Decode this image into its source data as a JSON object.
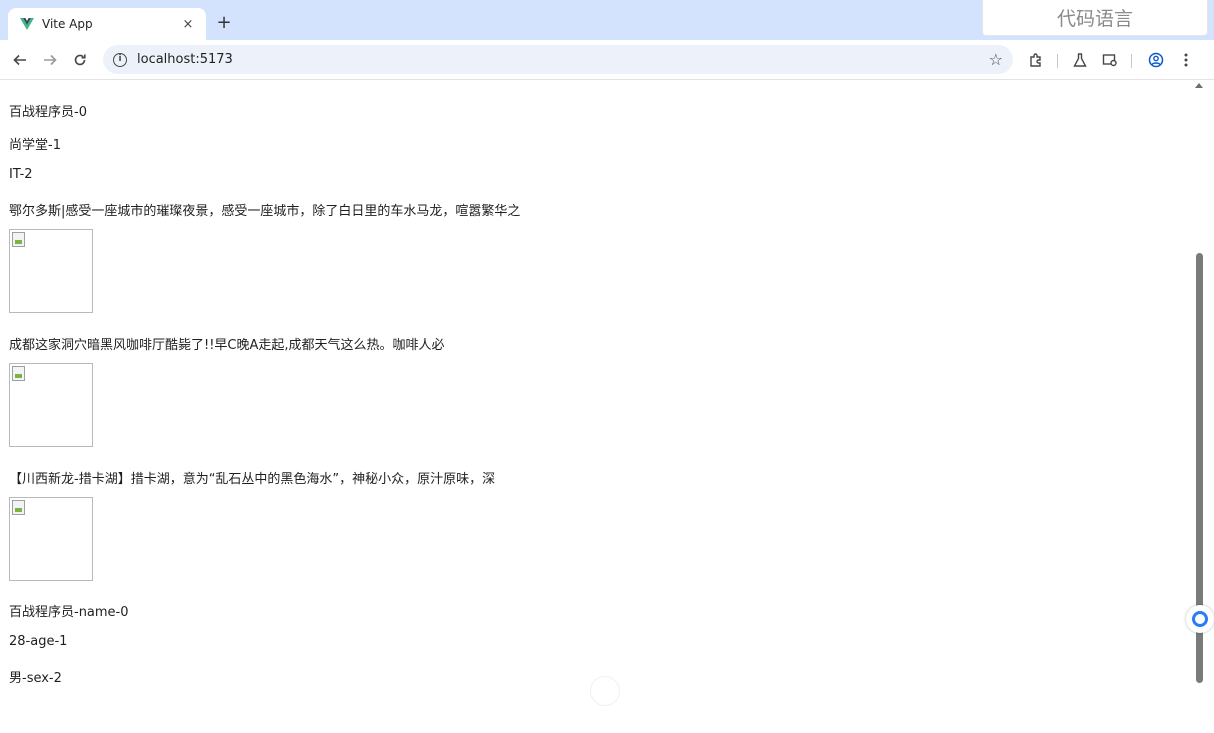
{
  "browser": {
    "tab": {
      "title": "Vite App",
      "close": "×"
    },
    "new_tab": "+",
    "url": "localhost:5173"
  },
  "overlay": {
    "text": "代码语言"
  },
  "page": {
    "simple_list": [
      "百战程序员-0",
      "尚学堂-1",
      "IT-2"
    ],
    "articles": [
      "鄂尔多斯|感受一座城市的璀璨夜景，感受一座城市，除了白日里的车水马龙，喧嚣繁华之",
      "成都这家洞穴暗黑风咖啡厅酷毙了!!早C晚A走起,成都天气这么热。咖啡人必",
      "【川西新龙-措卡湖】措卡湖，意为“乱石丛中的黑色海水”，神秘小众，原汁原味，深"
    ],
    "object_list": [
      "百战程序员-name-0",
      "28-age-1",
      "男-sex-2"
    ]
  },
  "colors": {
    "tab_strip": "#d3e3fd",
    "omnibox": "#edf2fa",
    "vue_green": "#41b883",
    "vue_dark": "#35495e"
  }
}
